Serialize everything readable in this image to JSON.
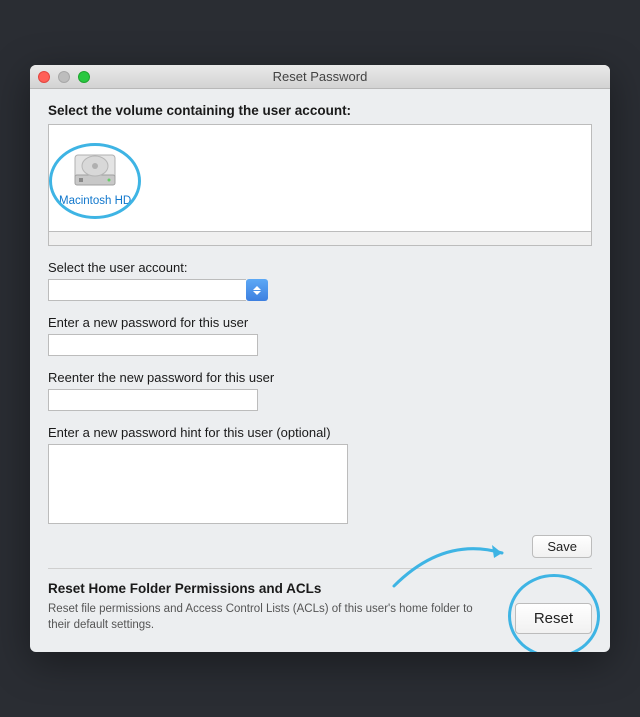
{
  "colors": {
    "highlight": "#3eb4e4",
    "window_bg": "#eceef0"
  },
  "titlebar": {
    "title": "Reset Password"
  },
  "volume": {
    "heading": "Select the volume containing the user account:",
    "selected_name": "Macintosh HD"
  },
  "user_select": {
    "label": "Select the user account:",
    "value": ""
  },
  "password_new": {
    "label": "Enter a new password for this user",
    "value": ""
  },
  "password_reenter": {
    "label": "Reenter the new password for this user",
    "value": ""
  },
  "password_hint": {
    "label": "Enter a new password hint for this user (optional)",
    "value": ""
  },
  "buttons": {
    "save": "Save",
    "reset": "Reset"
  },
  "acl": {
    "heading": "Reset Home Folder Permissions and ACLs",
    "description": "Reset file permissions and Access Control Lists (ACLs) of this user's home folder to their default settings."
  }
}
